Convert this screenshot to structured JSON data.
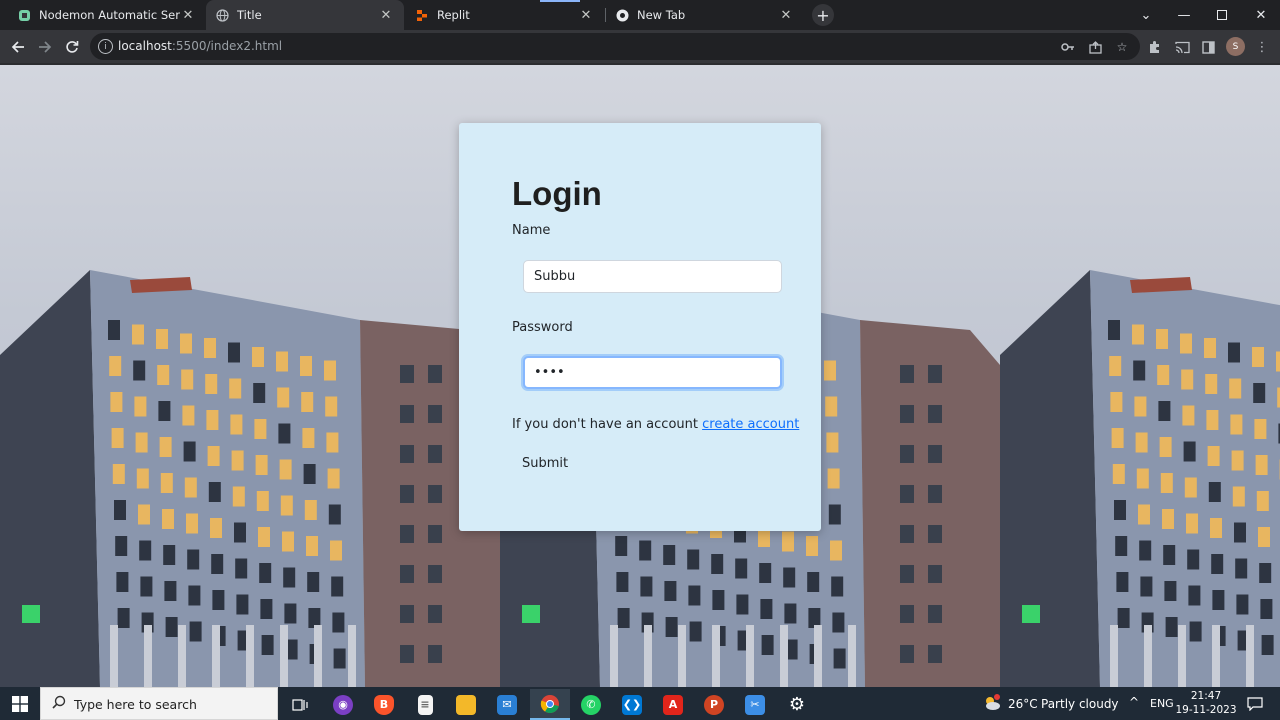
{
  "browser": {
    "tabs": [
      {
        "title": "Nodemon Automatic Server Run",
        "icon": "nodemon-icon",
        "active": false
      },
      {
        "title": "Title",
        "icon": "globe-icon",
        "active": true
      },
      {
        "title": "Replit",
        "icon": "replit-icon",
        "active": false
      },
      {
        "title": "New Tab",
        "icon": "chrome-icon",
        "active": false
      }
    ],
    "url_host": "localhost",
    "url_path": ":5500/index2.html",
    "avatar_letter": "S"
  },
  "login": {
    "title": "Login",
    "name_label": "Name",
    "name_value": "Subbu",
    "password_label": "Password",
    "password_value": "••••",
    "no_account_text": "If you don't have an account",
    "create_account_link": "create account",
    "submit_label": "Submit"
  },
  "taskbar": {
    "search_placeholder": "Type here to search",
    "weather_temp": "26°C",
    "weather_text": "Partly cloudy",
    "language": "ENG",
    "time": "21:47",
    "date": "19-11-2023",
    "notification_count": "1"
  },
  "colors": {
    "card_bg": "#d6ecf8",
    "link": "#0d6efd",
    "focus_ring": "#86b7fe",
    "taskbar": "#1f2a36"
  }
}
